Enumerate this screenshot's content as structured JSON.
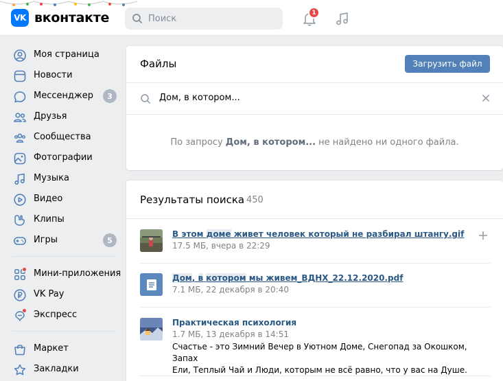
{
  "header": {
    "logo_badge": "VK",
    "logo_text": "вконтакте",
    "search_placeholder": "Поиск",
    "notifications_count": "1"
  },
  "sidebar": {
    "items": [
      {
        "label": "Моя страница",
        "icon": "user-circle-icon"
      },
      {
        "label": "Новости",
        "icon": "news-icon"
      },
      {
        "label": "Мессенджер",
        "icon": "message-icon",
        "count": "3"
      },
      {
        "label": "Друзья",
        "icon": "friends-icon"
      },
      {
        "label": "Сообщества",
        "icon": "communities-icon"
      },
      {
        "label": "Фотографии",
        "icon": "photo-icon"
      },
      {
        "label": "Музыка",
        "icon": "music-icon"
      },
      {
        "label": "Видео",
        "icon": "video-icon"
      },
      {
        "label": "Клипы",
        "icon": "clips-icon"
      },
      {
        "label": "Игры",
        "icon": "gamepad-icon",
        "count": "5"
      },
      {
        "label": "Мини-приложения",
        "icon": "apps-icon"
      },
      {
        "label": "VK Pay",
        "icon": "vkpay-icon"
      },
      {
        "label": "Экспресс",
        "icon": "express-icon"
      },
      {
        "label": "Маркет",
        "icon": "market-icon"
      },
      {
        "label": "Закладки",
        "icon": "bookmark-icon"
      }
    ]
  },
  "files": {
    "title": "Файлы",
    "upload_button": "Загрузить файл",
    "query": "Дом, в котором...",
    "empty_prefix": "По запросу ",
    "empty_query": "Дом, в котором...",
    "empty_suffix": " не найдено ни одного файла."
  },
  "results": {
    "title": "Результаты поиска",
    "count": "450",
    "items": [
      {
        "title_parts": [
          "В этом ",
          "доме",
          " живет человек который не разбирал штангу.gif"
        ],
        "meta": "17.5 МБ, вчера в 22:29",
        "type": "image"
      },
      {
        "title_parts": [
          "Дом",
          ", ",
          "в",
          " ",
          "котором",
          " мы живем_ВДНХ_22.12.2020.pdf"
        ],
        "meta": "7.1 МБ, 22 декабря в 20:40",
        "type": "document"
      },
      {
        "title": "Практическая психология",
        "meta": "1.7 МБ, 13 декабря в 14:51",
        "desc_line1": "Счастье - это Зимний Вечер в Уютном Доме, Снегопад за Окошком, Запах",
        "desc_line2": "Ели, Теплый Чай и Люди, которым не всё равно, что у вас на Душе.",
        "type": "image"
      }
    ]
  },
  "colors": {
    "accent": "#5181b8",
    "link": "#2a5885",
    "badge_red": "#e64646",
    "background": "#edeef0"
  }
}
